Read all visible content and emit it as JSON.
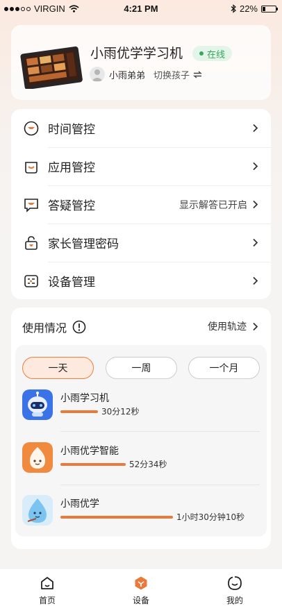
{
  "status_bar": {
    "carrier": "VIRGIN",
    "time": "4:21 PM",
    "battery": "22%",
    "battery_level": 0.22
  },
  "device": {
    "name": "小雨优学学习机",
    "status": "在线",
    "child_name": "小雨弟弟",
    "switch_label": "切换孩子",
    "switch_icon": "swap-arrows-icon"
  },
  "menu": {
    "items": [
      {
        "label": "时间管控",
        "icon": "time-control-icon",
        "value": ""
      },
      {
        "label": "应用管控",
        "icon": "app-control-icon",
        "value": ""
      },
      {
        "label": "答疑管控",
        "icon": "qa-control-icon",
        "value": "显示解答已开启"
      },
      {
        "label": "家长管理密码",
        "icon": "lock-icon",
        "value": ""
      },
      {
        "label": "设备管理",
        "icon": "device-manage-icon",
        "value": ""
      }
    ]
  },
  "usage": {
    "title": "使用情况",
    "trace_link": "使用轨迹",
    "tabs": [
      "一天",
      "一周",
      "一个月"
    ],
    "active_tab": "一天",
    "apps": [
      {
        "name": "小雨学习机",
        "duration": "30分12秒",
        "seconds": 1812
      },
      {
        "name": "小雨优学智能",
        "duration": "52分34秒",
        "seconds": 3154
      },
      {
        "name": "小雨优学",
        "duration": "1小时30分钟10秒",
        "seconds": 5410
      }
    ]
  },
  "tabbar": {
    "items": [
      {
        "label": "首页",
        "icon": "home-icon",
        "active": false
      },
      {
        "label": "设备",
        "icon": "device-icon",
        "active": true
      },
      {
        "label": "我的",
        "icon": "profile-icon",
        "active": false
      }
    ]
  },
  "colors": {
    "accent": "#ea7a39",
    "online_green": "#3aa65c",
    "tab_active_bg": "#fde9dd"
  }
}
